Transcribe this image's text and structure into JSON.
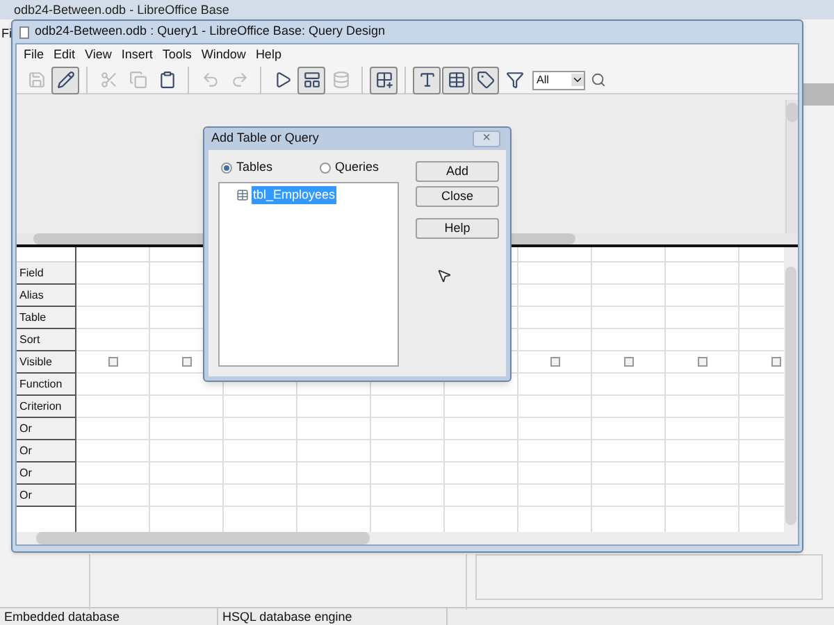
{
  "main_window": {
    "title": "odb24-Between.odb - LibreOffice Base",
    "menu_fragment": "Fi"
  },
  "query_window": {
    "title": "odb24-Between.odb : Query1 - LibreOffice Base: Query Design",
    "menu": [
      "File",
      "Edit",
      "View",
      "Insert",
      "Tools",
      "Window",
      "Help"
    ],
    "toolbar": [
      {
        "kind": "save",
        "disabled": true,
        "pressed": false
      },
      {
        "kind": "edit",
        "disabled": false,
        "pressed": true
      },
      {
        "kind": "sep"
      },
      {
        "kind": "cut",
        "disabled": true,
        "pressed": false
      },
      {
        "kind": "copy",
        "disabled": true,
        "pressed": false
      },
      {
        "kind": "paste",
        "disabled": false,
        "pressed": false
      },
      {
        "kind": "sep"
      },
      {
        "kind": "undo",
        "disabled": true,
        "pressed": false
      },
      {
        "kind": "redo",
        "disabled": true,
        "pressed": false
      },
      {
        "kind": "sep"
      },
      {
        "kind": "run",
        "disabled": false,
        "pressed": false
      },
      {
        "kind": "design",
        "disabled": false,
        "pressed": true
      },
      {
        "kind": "sql",
        "disabled": true,
        "pressed": false
      },
      {
        "kind": "sep"
      },
      {
        "kind": "addtable",
        "disabled": false,
        "pressed": true
      },
      {
        "kind": "sep"
      },
      {
        "kind": "function",
        "disabled": false,
        "pressed": true
      },
      {
        "kind": "tablename",
        "disabled": false,
        "pressed": true
      },
      {
        "kind": "alias",
        "disabled": false,
        "pressed": true
      },
      {
        "kind": "filter",
        "disabled": false,
        "pressed": false
      }
    ],
    "limit": {
      "value": "All"
    },
    "row_labels": [
      "Field",
      "Alias",
      "Table",
      "Sort",
      "Visible",
      "Function",
      "Criterion",
      "Or",
      "Or",
      "Or",
      "Or"
    ],
    "columns": [
      {
        "visible_checked": false
      },
      {
        "visible_checked": false
      },
      {},
      {},
      {},
      {},
      {
        "visible_checked": false
      },
      {
        "visible_checked": false
      },
      {
        "visible_checked": false
      },
      {
        "visible_checked": false
      }
    ]
  },
  "dialog": {
    "title": "Add Table or Query",
    "close": "×",
    "radios": [
      {
        "label": "Tables",
        "selected": true
      },
      {
        "label": "Queries",
        "selected": false
      }
    ],
    "items": [
      {
        "label": "tbl_Employees",
        "selected": true
      }
    ],
    "buttons": [
      "Add",
      "Close",
      "Help"
    ]
  },
  "status_bar": [
    "Embedded database",
    "HSQL database engine"
  ]
}
